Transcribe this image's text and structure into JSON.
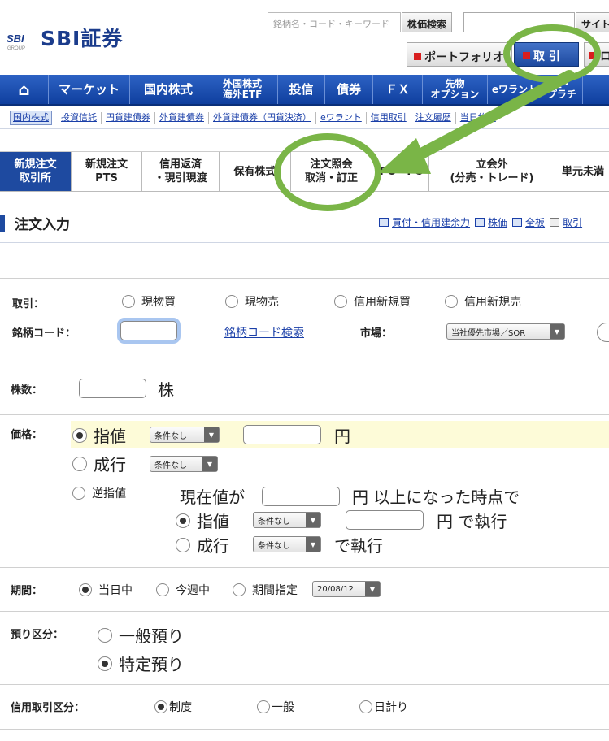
{
  "header": {
    "logo_mark": "SBI",
    "logo_group": "GROUP",
    "logo_text": "SBI証券",
    "search_placeholder": "銘柄名・コード・キーワード",
    "stock_search_button": "株価検索",
    "site_search_button": "サイト",
    "portfolio_button": "ポートフォリオ",
    "trade_button": "取 引",
    "logout_button": "ロ"
  },
  "mainnav": [
    {
      "label": "⌂",
      "icon": "home-icon"
    },
    {
      "label": "マーケット"
    },
    {
      "label": "国内株式"
    },
    {
      "label": "外国株式\n海外ETF"
    },
    {
      "label": "投信"
    },
    {
      "label": "債券"
    },
    {
      "label": "ＦＸ"
    },
    {
      "label": "先物\nオプション"
    },
    {
      "label": "eワラント"
    },
    {
      "label": "金・\nプラチ"
    }
  ],
  "subnav": [
    "国内株式",
    "投資信託",
    "円貨建債券",
    "外貨建債券",
    "外貨建債券（円貨決済）",
    "eワラント",
    "信用取引",
    "注文履歴",
    "当日約定"
  ],
  "tabs": [
    {
      "label": "新規注文\n取引所"
    },
    {
      "label": "新規注文\nPTS"
    },
    {
      "label": "信用返済\n・現引現渡"
    },
    {
      "label": "保有株式"
    },
    {
      "label": "注文照会\n取消・訂正"
    },
    {
      "label": "IPO・PO"
    },
    {
      "label": "立会外\n(分売・トレード)"
    },
    {
      "label": "単元未満"
    }
  ],
  "section_title": "注文入力",
  "top_links": [
    "買付・信用建余力",
    "株価",
    "全板",
    "取引"
  ],
  "form": {
    "trade_label": "取引：",
    "trade_options": [
      "現物買",
      "現物売",
      "信用新規買",
      "信用新規売"
    ],
    "code_label": "銘柄コード：",
    "code_search_link": "銘柄コード検索",
    "market_label": "市場：",
    "market_value": "当社優先市場／SOR",
    "shares_label": "株数：",
    "shares_unit": "株",
    "price_label": "価格：",
    "limit_label": "指値",
    "market_order_label": "成行",
    "stop_label": "逆指値",
    "condition_none": "条件なし",
    "yen": "円",
    "stop_prefix": "現在値が",
    "stop_suffix": "円 以上になった時点で",
    "stop_limit_label": "指値",
    "stop_market_label": "成行",
    "execute_suffix_yen": "円 で執行",
    "execute_suffix": "で執行",
    "period_label": "期間：",
    "period_options": [
      "当日中",
      "今週中",
      "期間指定"
    ],
    "period_date": "20/08/12",
    "custody_label": "預り区分：",
    "custody_options": [
      "一般預り",
      "特定預り"
    ],
    "margin_label": "信用取引区分：",
    "margin_options": [
      "制度",
      "一般",
      "日計り"
    ]
  },
  "colors": {
    "brand_blue": "#1e4aa0",
    "annotation_green": "#7ab547",
    "highlight_yellow": "#fdfbd8"
  }
}
